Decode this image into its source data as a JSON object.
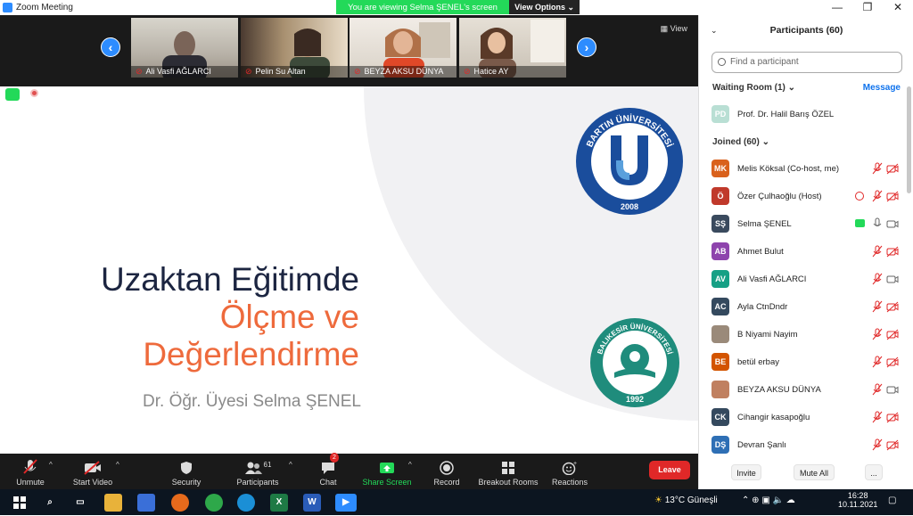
{
  "window": {
    "title": "Zoom Meeting"
  },
  "banner": {
    "message": "You are viewing Selma ŞENEL's screen",
    "view_options": "View Options ⌄"
  },
  "thumbs": {
    "view_label": "View",
    "items": [
      {
        "name": "Ali Vasfi AĞLARCI"
      },
      {
        "name": "Pelin Su Altan"
      },
      {
        "name": "BEYZA AKSU DÜNYA"
      },
      {
        "name": "Hatice AY"
      }
    ]
  },
  "slide": {
    "line1": "Uzaktan Eğitimde",
    "line2": "Ölçme ve",
    "line3": "Değerlendirme",
    "author": "Dr. Öğr. Üyesi Selma ŞENEL",
    "logo1": {
      "top_text": "BARTIN ÜNİVERSİTESİ",
      "year": "2008"
    },
    "logo2": {
      "top_text": "BALIKESİR ÜNİVERSİTESİ",
      "year": "1992"
    }
  },
  "toolbar": {
    "unmute": "Unmute",
    "start_video": "Start Video",
    "security": "Security",
    "participants": "Participants",
    "participants_count": "61",
    "chat": "Chat",
    "chat_badge": "2",
    "share_screen": "Share Screen",
    "record": "Record",
    "breakout": "Breakout Rooms",
    "reactions": "Reactions",
    "leave": "Leave"
  },
  "panel": {
    "title": "Participants (60)",
    "search_placeholder": "Find a participant",
    "waiting_room": "Waiting Room (1)",
    "message": "Message",
    "joined": "Joined (60)",
    "invite": "Invite",
    "mute_all": "Mute All",
    "more": "...",
    "waiting": [
      {
        "initials": "PD",
        "name": "Prof. Dr. Halil Barış ÖZEL",
        "color": "#b9dfd4"
      }
    ],
    "participants": [
      {
        "initials": "MK",
        "name": "Melis Köksal (Co-host, me)",
        "color": "#d9611c"
      },
      {
        "initials": "Ö",
        "name": "Özer Çulhaoğlu (Host)",
        "color": "#c0392b"
      },
      {
        "initials": "SŞ",
        "name": "Selma ŞENEL",
        "color": "#3a4a5e"
      },
      {
        "initials": "AB",
        "name": "Ahmet Bulut",
        "color": "#8e44ad"
      },
      {
        "initials": "AV",
        "name": "Ali Vasfi AĞLARCI",
        "color": "#16a085"
      },
      {
        "initials": "AC",
        "name": "Ayla CtnDndr",
        "color": "#34495e"
      },
      {
        "initials": "",
        "name": "B Niyami Nayim",
        "color": "#9a8a7a"
      },
      {
        "initials": "BE",
        "name": "betül erbay",
        "color": "#d35400"
      },
      {
        "initials": "",
        "name": "BEYZA AKSU DÜNYA",
        "color": "#c08060"
      },
      {
        "initials": "CK",
        "name": "Cihangir kasapoğlu",
        "color": "#34495e"
      },
      {
        "initials": "DŞ",
        "name": "Devran Şanlı",
        "color": "#2e6fb5"
      }
    ]
  },
  "taskbar": {
    "weather": "13°C Güneşli",
    "time": "16:28",
    "date": "10.11.2021"
  }
}
